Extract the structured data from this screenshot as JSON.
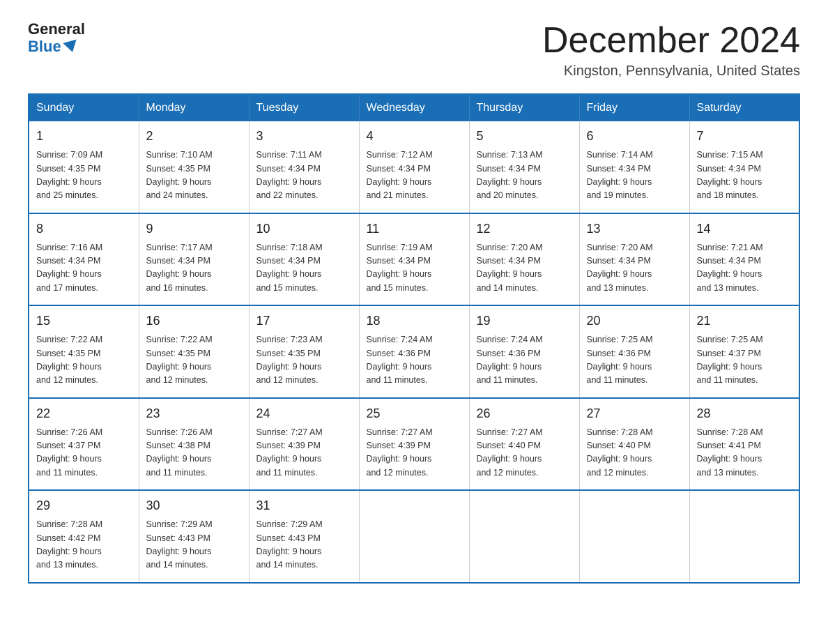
{
  "header": {
    "logo_general": "General",
    "logo_blue": "Blue",
    "month_title": "December 2024",
    "location": "Kingston, Pennsylvania, United States"
  },
  "calendar": {
    "days_of_week": [
      "Sunday",
      "Monday",
      "Tuesday",
      "Wednesday",
      "Thursday",
      "Friday",
      "Saturday"
    ],
    "weeks": [
      [
        {
          "day": "1",
          "sunrise": "7:09 AM",
          "sunset": "4:35 PM",
          "daylight": "9 hours and 25 minutes."
        },
        {
          "day": "2",
          "sunrise": "7:10 AM",
          "sunset": "4:35 PM",
          "daylight": "9 hours and 24 minutes."
        },
        {
          "day": "3",
          "sunrise": "7:11 AM",
          "sunset": "4:34 PM",
          "daylight": "9 hours and 22 minutes."
        },
        {
          "day": "4",
          "sunrise": "7:12 AM",
          "sunset": "4:34 PM",
          "daylight": "9 hours and 21 minutes."
        },
        {
          "day": "5",
          "sunrise": "7:13 AM",
          "sunset": "4:34 PM",
          "daylight": "9 hours and 20 minutes."
        },
        {
          "day": "6",
          "sunrise": "7:14 AM",
          "sunset": "4:34 PM",
          "daylight": "9 hours and 19 minutes."
        },
        {
          "day": "7",
          "sunrise": "7:15 AM",
          "sunset": "4:34 PM",
          "daylight": "9 hours and 18 minutes."
        }
      ],
      [
        {
          "day": "8",
          "sunrise": "7:16 AM",
          "sunset": "4:34 PM",
          "daylight": "9 hours and 17 minutes."
        },
        {
          "day": "9",
          "sunrise": "7:17 AM",
          "sunset": "4:34 PM",
          "daylight": "9 hours and 16 minutes."
        },
        {
          "day": "10",
          "sunrise": "7:18 AM",
          "sunset": "4:34 PM",
          "daylight": "9 hours and 15 minutes."
        },
        {
          "day": "11",
          "sunrise": "7:19 AM",
          "sunset": "4:34 PM",
          "daylight": "9 hours and 15 minutes."
        },
        {
          "day": "12",
          "sunrise": "7:20 AM",
          "sunset": "4:34 PM",
          "daylight": "9 hours and 14 minutes."
        },
        {
          "day": "13",
          "sunrise": "7:20 AM",
          "sunset": "4:34 PM",
          "daylight": "9 hours and 13 minutes."
        },
        {
          "day": "14",
          "sunrise": "7:21 AM",
          "sunset": "4:34 PM",
          "daylight": "9 hours and 13 minutes."
        }
      ],
      [
        {
          "day": "15",
          "sunrise": "7:22 AM",
          "sunset": "4:35 PM",
          "daylight": "9 hours and 12 minutes."
        },
        {
          "day": "16",
          "sunrise": "7:22 AM",
          "sunset": "4:35 PM",
          "daylight": "9 hours and 12 minutes."
        },
        {
          "day": "17",
          "sunrise": "7:23 AM",
          "sunset": "4:35 PM",
          "daylight": "9 hours and 12 minutes."
        },
        {
          "day": "18",
          "sunrise": "7:24 AM",
          "sunset": "4:36 PM",
          "daylight": "9 hours and 11 minutes."
        },
        {
          "day": "19",
          "sunrise": "7:24 AM",
          "sunset": "4:36 PM",
          "daylight": "9 hours and 11 minutes."
        },
        {
          "day": "20",
          "sunrise": "7:25 AM",
          "sunset": "4:36 PM",
          "daylight": "9 hours and 11 minutes."
        },
        {
          "day": "21",
          "sunrise": "7:25 AM",
          "sunset": "4:37 PM",
          "daylight": "9 hours and 11 minutes."
        }
      ],
      [
        {
          "day": "22",
          "sunrise": "7:26 AM",
          "sunset": "4:37 PM",
          "daylight": "9 hours and 11 minutes."
        },
        {
          "day": "23",
          "sunrise": "7:26 AM",
          "sunset": "4:38 PM",
          "daylight": "9 hours and 11 minutes."
        },
        {
          "day": "24",
          "sunrise": "7:27 AM",
          "sunset": "4:39 PM",
          "daylight": "9 hours and 11 minutes."
        },
        {
          "day": "25",
          "sunrise": "7:27 AM",
          "sunset": "4:39 PM",
          "daylight": "9 hours and 12 minutes."
        },
        {
          "day": "26",
          "sunrise": "7:27 AM",
          "sunset": "4:40 PM",
          "daylight": "9 hours and 12 minutes."
        },
        {
          "day": "27",
          "sunrise": "7:28 AM",
          "sunset": "4:40 PM",
          "daylight": "9 hours and 12 minutes."
        },
        {
          "day": "28",
          "sunrise": "7:28 AM",
          "sunset": "4:41 PM",
          "daylight": "9 hours and 13 minutes."
        }
      ],
      [
        {
          "day": "29",
          "sunrise": "7:28 AM",
          "sunset": "4:42 PM",
          "daylight": "9 hours and 13 minutes."
        },
        {
          "day": "30",
          "sunrise": "7:29 AM",
          "sunset": "4:43 PM",
          "daylight": "9 hours and 14 minutes."
        },
        {
          "day": "31",
          "sunrise": "7:29 AM",
          "sunset": "4:43 PM",
          "daylight": "9 hours and 14 minutes."
        },
        null,
        null,
        null,
        null
      ]
    ],
    "labels": {
      "sunrise": "Sunrise:",
      "sunset": "Sunset:",
      "daylight": "Daylight:"
    }
  }
}
